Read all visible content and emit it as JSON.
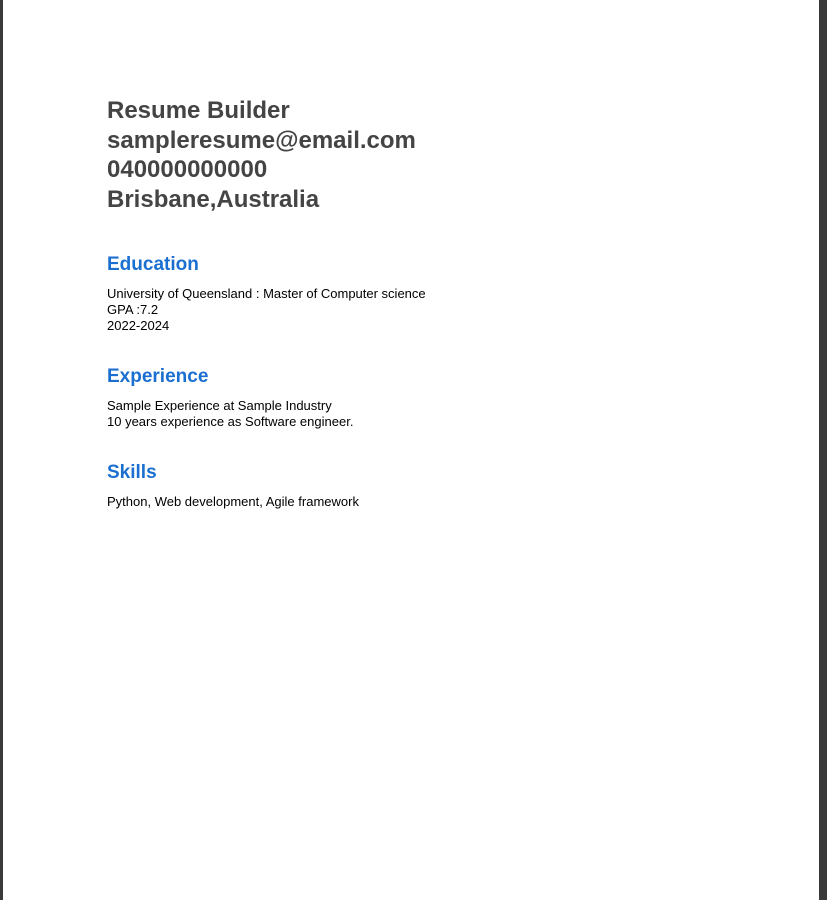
{
  "header": {
    "name": "Resume Builder",
    "email": "sampleresume@email.com",
    "phone": "040000000000",
    "location": "Brisbane,Australia"
  },
  "education": {
    "title": "Education",
    "lines": [
      "University of Queensland : Master of Computer science",
      "GPA :7.2",
      "2022-2024"
    ]
  },
  "experience": {
    "title": "Experience",
    "lines": [
      "Sample Experience at Sample Industry",
      "10 years experience as Software engineer."
    ]
  },
  "skills": {
    "title": "Skills",
    "lines": [
      "Python, Web development, Agile framework"
    ]
  },
  "colors": {
    "heading": "#444444",
    "section_title": "#1a6fd0",
    "body_text": "#000000",
    "page_bg": "#ffffff"
  }
}
